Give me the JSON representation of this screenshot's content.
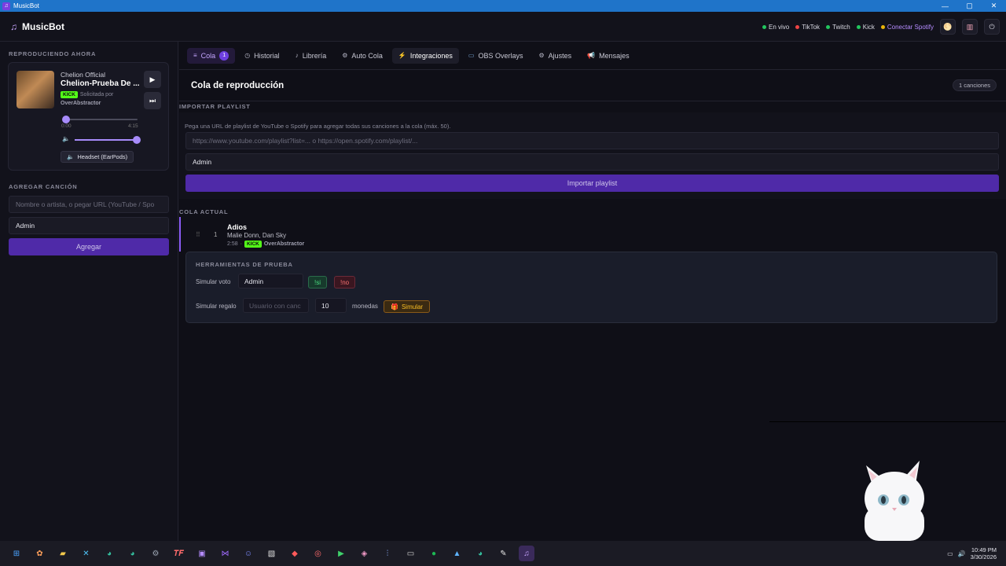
{
  "window": {
    "title": "MusicBot",
    "controls": [
      "—",
      "▢",
      "✕"
    ]
  },
  "header": {
    "brand": "MusicBot",
    "status": [
      {
        "label": "En vivo",
        "color": "#22c55e"
      },
      {
        "label": "TikTok",
        "color": "#ef4444"
      },
      {
        "label": "Twitch",
        "color": "#22c55e"
      },
      {
        "label": "Kick",
        "color": "#22c55e"
      },
      {
        "label": "Conectar Spotify",
        "color": "#eab308"
      }
    ],
    "icons": [
      "theme-icon",
      "notes-icon",
      "power-icon"
    ]
  },
  "sidebar": {
    "now_playing_label": "REPRODUCIENDO AHORA",
    "now_playing": {
      "artist": "Chelion Official",
      "title": "Chelion-Prueba De ...",
      "platform": "KICK",
      "requested_by_label": "Solicitada por",
      "requested_by": "OverAbstractor",
      "time_current": "0:00",
      "time_total": "4:15",
      "progress": 0,
      "volume": 1.0,
      "device": "Headset (EarPods)"
    },
    "add_song_label": "AGREGAR CANCIÓN",
    "search_placeholder": "Nombre o artista, o pegar URL (YouTube / Spo",
    "user_field": "Admin",
    "add_button": "Agregar"
  },
  "tabs": [
    {
      "label": "Cola",
      "icon": "≡",
      "badge": "1",
      "state": "active"
    },
    {
      "label": "Historial",
      "icon": "◷"
    },
    {
      "label": "Librería",
      "icon": "♪"
    },
    {
      "label": "Auto Cola",
      "icon": "⚙"
    },
    {
      "label": "Integraciones",
      "icon": "⚡",
      "state": "hover"
    },
    {
      "label": "OBS Overlays",
      "icon": "▭"
    },
    {
      "label": "Ajustes",
      "icon": "⚙"
    },
    {
      "label": "Mensajes",
      "icon": "📢"
    }
  ],
  "queue": {
    "title": "Cola de reproducción",
    "count": "1 canciones",
    "import_label": "IMPORTAR PLAYLIST",
    "import_desc": "Pega una URL de playlist de YouTube o Spotify para agregar todas sus canciones a la cola (máx. 50).",
    "import_placeholder": "https://www.youtube.com/playlist?list=... o https://open.spotify.com/playlist/...",
    "import_user": "Admin",
    "import_button": "Importar playlist",
    "current_label": "COLA ACTUAL",
    "items": [
      {
        "num": "1",
        "title": "Adios",
        "artist": "Malie Donn, Dan Sky",
        "duration": "2:58",
        "platform": "KICK",
        "user": "OverAbstractor"
      }
    ]
  },
  "tools": {
    "label": "HERRAMIENTAS DE PRUEBA",
    "vote_label": "Simular voto",
    "vote_user": "Admin",
    "vote_yes": "!si",
    "vote_no": "!no",
    "gift_label": "Simular regalo",
    "gift_user_placeholder": "Usuario con canc",
    "gift_amount": "10",
    "gift_unit": "monedas",
    "gift_button": "Simular"
  },
  "taskbar": {
    "clock_time": "10:49 PM",
    "clock_date": "3/30/2026"
  }
}
